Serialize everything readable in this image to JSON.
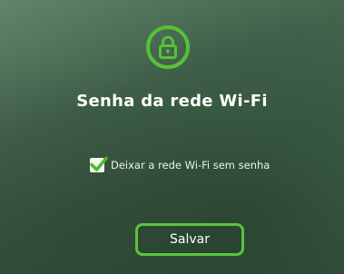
{
  "dialog": {
    "icon": "lock-icon",
    "title": "Senha da rede Wi-Fi",
    "checkbox": {
      "label": "Deixar a rede Wi-Fi sem senha",
      "checked": true,
      "icon": "checkmark-icon"
    },
    "save_label": "Salvar"
  },
  "colors": {
    "accent": "#55c23a",
    "background": "#3d5c46",
    "text": "#ffffff"
  }
}
